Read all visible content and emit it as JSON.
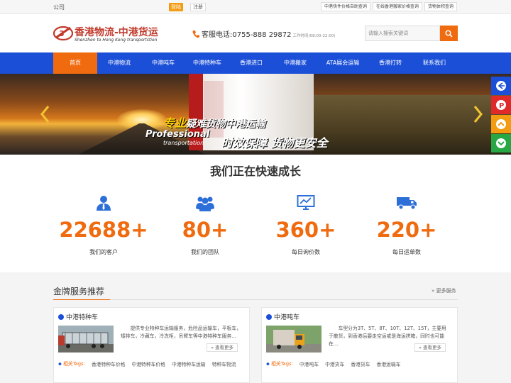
{
  "topbar": {
    "company": "公司",
    "login": "登陆",
    "register": "注册",
    "links": [
      "中港快件价格自助查询",
      "在线香港搬家价格查询",
      "货物体积查询"
    ]
  },
  "header": {
    "logo_cn": "香港物流-中港货运",
    "logo_en": "Shenzhen to Hong Kong transportstion",
    "phone": "客服电话:0755-888 29872",
    "hours": "工作时间(08:00-22:00)",
    "search_placeholder": "请输入搜索关键词"
  },
  "nav": [
    "首页",
    "中港物流",
    "中港吨车",
    "中港特种车",
    "香港进口",
    "中港搬家",
    "ATA展会运输",
    "香港打转",
    "联系我们"
  ],
  "banner": {
    "slogan_highlight": "专业",
    "slogan_rest": "疑难货物中港运输",
    "slogan_en1": "Professional",
    "slogan_en2": "transportation",
    "slogan_2": "时效保障 货物更安全"
  },
  "stats": {
    "title": "我们正在快速成长",
    "items": [
      {
        "num": "22688+",
        "label": "我们的客户",
        "icon": "user-icon"
      },
      {
        "num": "80+",
        "label": "我们的团队",
        "icon": "team-icon"
      },
      {
        "num": "360+",
        "label": "每日询价数",
        "icon": "monitor-chart-icon"
      },
      {
        "num": "220+",
        "label": "每日运单数",
        "icon": "truck-icon"
      }
    ]
  },
  "services": {
    "title": "金牌服务推荐",
    "more": "更多服务",
    "cards": [
      {
        "title": "中港特种车",
        "desc": "提供专业特种车运输服务，危险品运输车，平板车，矮排车，冷藏车，冷冻柜，吊臂车等中港特种车服务...",
        "view_more": "查看更多",
        "tags_label": "相关Tags:",
        "tags": [
          "香港特种车价格",
          "中港特种车价格",
          "中港特种车运输",
          "特种车物流"
        ]
      },
      {
        "title": "中港吨车",
        "desc": "车型分为3T、5T、8T、10T、12T、15T，主要用于散货，到香港后要走空运或是海运拼箱，同时也可能在...",
        "view_more": "查看更多",
        "tags_label": "相关Tags:",
        "tags": [
          "中港吨车",
          "中港货车",
          "香港货车",
          "香港运输车"
        ]
      }
    ]
  },
  "colors": {
    "nav": "#1b4fd8",
    "accent": "#f06b0f"
  }
}
